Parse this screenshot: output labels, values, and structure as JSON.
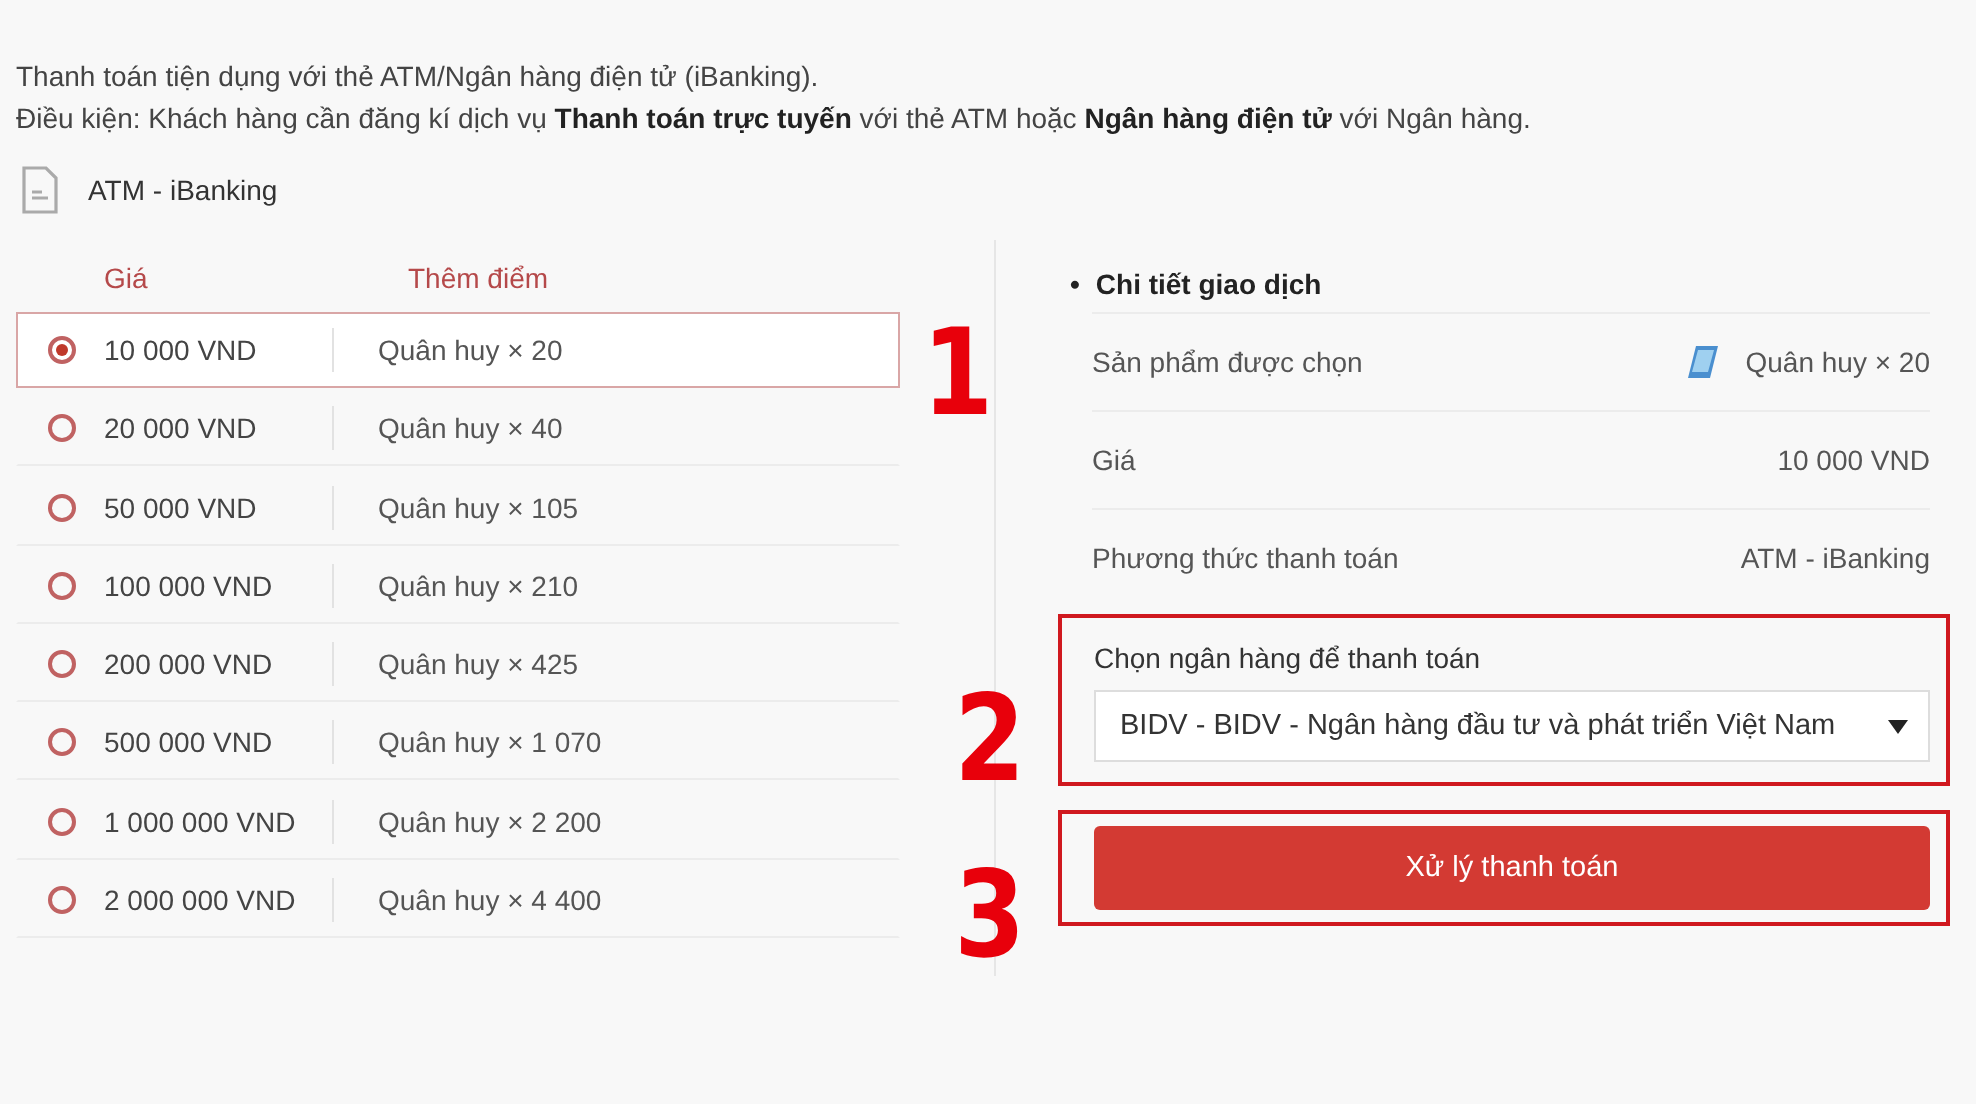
{
  "intro": {
    "line1": "Thanh toán tiện dụng với thẻ ATM/Ngân hàng điện tử (iBanking).",
    "line2": "Điều kiện: Khách hàng cần đăng kí dịch vụ **Thanh toán trực tuyến** với thẻ ATM hoặc **Ngân hàng điện tử** với Ngân hàng."
  },
  "method": {
    "label": "ATM - iBanking"
  },
  "packages": {
    "columns": [
      "Giá",
      "Thêm điểm"
    ],
    "rows": [
      {
        "price": "10 000 VND",
        "points": "Quân huy × 20",
        "selected": true
      },
      {
        "price": "20 000 VND",
        "points": "Quân huy × 40",
        "selected": false
      },
      {
        "price": "50 000 VND",
        "points": "Quân huy × 105",
        "selected": false
      },
      {
        "price": "100 000 VND",
        "points": "Quân huy × 210",
        "selected": false
      },
      {
        "price": "200 000 VND",
        "points": "Quân huy × 425",
        "selected": false
      },
      {
        "price": "500 000 VND",
        "points": "Quân huy × 1 070",
        "selected": false
      },
      {
        "price": "1 000 000 VND",
        "points": "Quân huy × 2 200",
        "selected": false
      },
      {
        "price": "2 000 000 VND",
        "points": "Quân huy × 4 400",
        "selected": false
      }
    ]
  },
  "details": {
    "bullet": "•",
    "title": "Chi tiết giao dịch",
    "rows": [
      {
        "kind": "product",
        "label": "Sản phẩm được chọn",
        "value": "Quân huy × 20"
      },
      {
        "kind": "text",
        "label": "Giá",
        "value": "10 000 VND"
      },
      {
        "kind": "text",
        "label": "Phương thức thanh toán",
        "value": "ATM - iBanking"
      }
    ]
  },
  "bank": {
    "label": "Chọn ngân hàng để thanh toán",
    "value": "BIDV - BIDV - Ngân hàng đầu tư và phát triển Việt Nam"
  },
  "submit": {
    "label": "Xử lý thanh toán"
  },
  "annotations": [
    {
      "number": "1"
    },
    {
      "number": "2"
    },
    {
      "number": "3"
    }
  ]
}
